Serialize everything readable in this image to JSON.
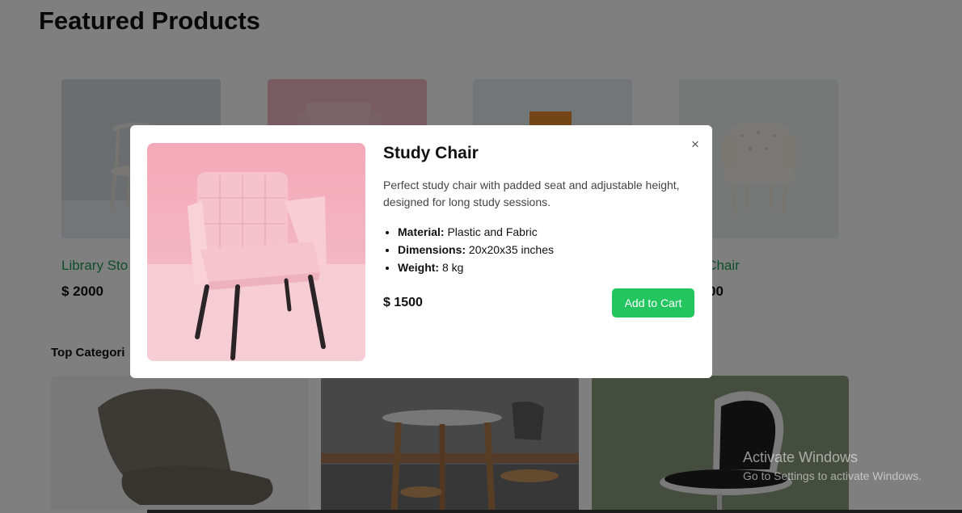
{
  "page": {
    "title": "Featured Products",
    "top_categories_label": "Top Categori"
  },
  "products": [
    {
      "name": "Library Sto",
      "price": "$ 2000"
    },
    {
      "name": "",
      "price": ""
    },
    {
      "name": "",
      "price": ""
    },
    {
      "name": "g Chair",
      "price": "00"
    }
  ],
  "modal": {
    "title": "Study Chair",
    "description": "Perfect study chair with padded seat and adjustable height, designed for long study sessions.",
    "specs": [
      {
        "label": "Material:",
        "value": "Plastic and Fabric"
      },
      {
        "label": "Dimensions:",
        "value": "20x20x35 inches"
      },
      {
        "label": "Weight:",
        "value": "8 kg"
      }
    ],
    "price": "$ 1500",
    "add_to_cart_label": "Add to Cart",
    "close_label": "×"
  },
  "watermark": {
    "title": "Activate Windows",
    "subtitle": "Go to Settings to activate Windows."
  },
  "colors": {
    "accent_green": "#22c55e",
    "product_name_green": "#1f9d55",
    "overlay": "rgba(0,0,0,0.5)"
  }
}
